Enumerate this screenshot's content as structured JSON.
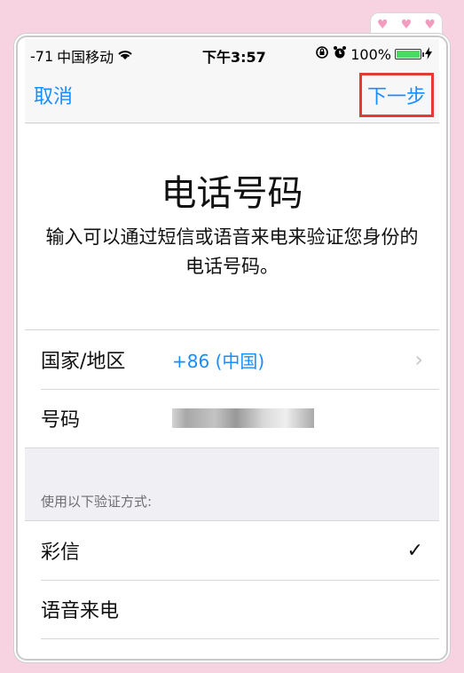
{
  "status": {
    "signal": "-71",
    "carrier": "中国移动",
    "time": "下午3:57",
    "battery": "100%"
  },
  "nav": {
    "cancel": "取消",
    "next": "下一步"
  },
  "header": {
    "title": "电话号码",
    "subtitle": "输入可以通过短信或语音来电来验证您身份的电话号码。"
  },
  "form": {
    "country_label": "国家/地区",
    "country_value": "+86 (中国)",
    "number_label": "号码"
  },
  "verify": {
    "section_header": "使用以下验证方式:",
    "options": [
      {
        "label": "彩信",
        "selected": true
      },
      {
        "label": "语音来电",
        "selected": false
      }
    ]
  },
  "colors": {
    "accent": "#1a8cff",
    "highlight_box": "#e53935",
    "battery": "#4cd964",
    "background": "#f7d3e2"
  }
}
